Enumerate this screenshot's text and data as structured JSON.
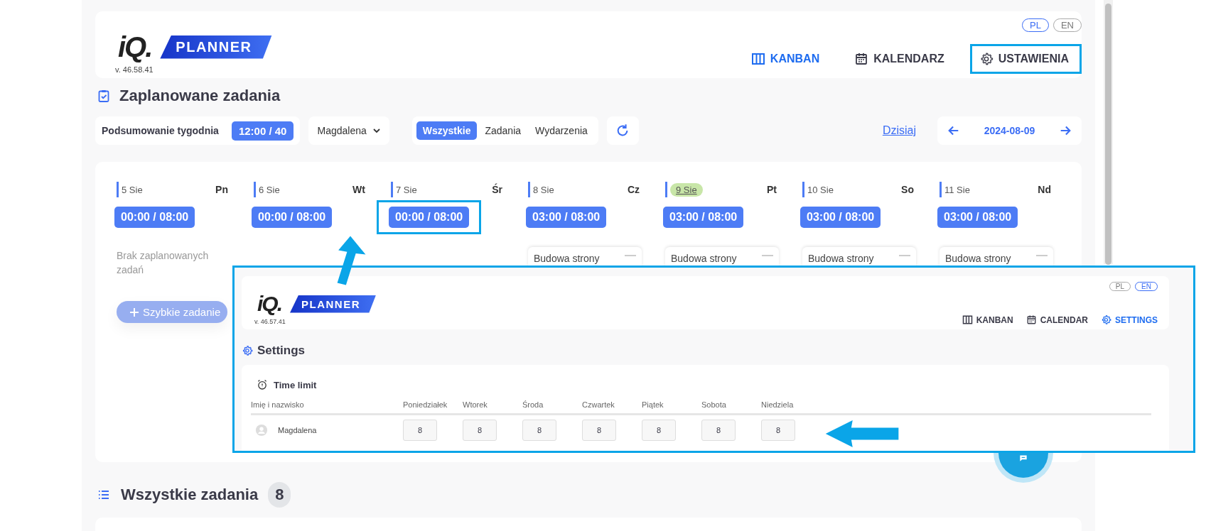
{
  "header": {
    "logo": {
      "mark": "iQ.",
      "name": "PLANNER"
    },
    "version": "v. 46.58.41",
    "languages": [
      {
        "label": "PL",
        "selected": true
      },
      {
        "label": "EN",
        "selected": false
      }
    ],
    "nav": [
      {
        "label": "KANBAN",
        "selected": true,
        "highlighted": false
      },
      {
        "label": "KALENDARZ",
        "selected": false,
        "highlighted": false
      },
      {
        "label": "USTAWIENIA",
        "selected": false,
        "highlighted": true
      }
    ]
  },
  "page_title": "Zaplanowane zadania",
  "toolbar": {
    "summary_label": "Podsumowanie tygodnia",
    "summary_value": "12:00 / 40",
    "person": "Magdalena",
    "filters": [
      {
        "label": "Wszystkie",
        "selected": true
      },
      {
        "label": "Zadania",
        "selected": false
      },
      {
        "label": "Wydarzenia",
        "selected": false
      }
    ],
    "today_link": "Dzisiaj",
    "date": "2024-08-09"
  },
  "days": [
    {
      "date": "5 Sie",
      "weekday": "Pn",
      "hours": "00:00 / 08:00",
      "today": false,
      "highlighted": false,
      "empty_text": "Brak zaplanowanych zadań",
      "quick_add": "Szybkie zadanie"
    },
    {
      "date": "6 Sie",
      "weekday": "Wt",
      "hours": "00:00 / 08:00",
      "today": false,
      "highlighted": false
    },
    {
      "date": "7 Sie",
      "weekday": "Śr",
      "hours": "00:00 / 08:00",
      "today": false,
      "highlighted": true
    },
    {
      "date": "8 Sie",
      "weekday": "Cz",
      "hours": "03:00 / 08:00",
      "today": false,
      "highlighted": false,
      "tasks": [
        {
          "title": "Budowa strony"
        }
      ]
    },
    {
      "date": "9 Sie",
      "weekday": "Pt",
      "hours": "03:00 / 08:00",
      "today": true,
      "highlighted": false,
      "tasks": [
        {
          "title": "Budowa strony"
        }
      ]
    },
    {
      "date": "10 Sie",
      "weekday": "So",
      "hours": "03:00 / 08:00",
      "today": false,
      "highlighted": false,
      "tasks": [
        {
          "title": "Budowa strony"
        }
      ]
    },
    {
      "date": "11 Sie",
      "weekday": "Nd",
      "hours": "03:00 / 08:00",
      "today": false,
      "highlighted": false,
      "tasks": [
        {
          "title": "Budowa strony"
        }
      ]
    }
  ],
  "all_tasks": {
    "title": "Wszystkie zadania",
    "count": "8"
  },
  "inset": {
    "logo": {
      "mark": "iQ.",
      "name": "PLANNER"
    },
    "version": "v. 46.57.41",
    "languages": [
      {
        "label": "PL",
        "selected": false
      },
      {
        "label": "EN",
        "selected": true
      }
    ],
    "nav": [
      {
        "label": "KANBAN",
        "selected": false
      },
      {
        "label": "CALENDAR",
        "selected": false
      },
      {
        "label": "SETTINGS",
        "selected": true
      }
    ],
    "title": "Settings",
    "card_title": "Time limit",
    "columns": [
      "Imię i nazwisko",
      "Poniedziałek",
      "Wtorek",
      "Środa",
      "Czwartek",
      "Piątek",
      "Sobota",
      "Niedziela"
    ],
    "rows": [
      {
        "name": "Magdalena",
        "values": [
          "8",
          "8",
          "8",
          "8",
          "8",
          "8",
          "8"
        ]
      }
    ]
  }
}
